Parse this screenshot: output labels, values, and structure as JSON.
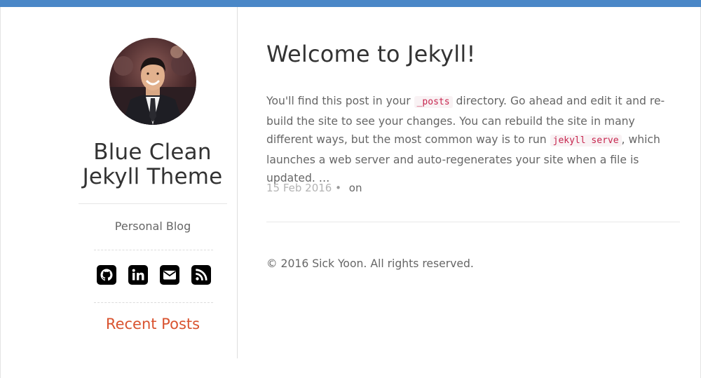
{
  "colors": {
    "topbar": "#4a87c7",
    "accent": "#d9532f",
    "code_text": "#c7254e",
    "code_bg": "#f9f2f4"
  },
  "sidebar": {
    "avatar_alt": "profile photo",
    "title_line1": "Blue Clean",
    "title_line2": "Jekyll Theme",
    "tagline": "Personal Blog",
    "social_icons": [
      "github-icon",
      "linkedin-icon",
      "email-icon",
      "rss-icon"
    ],
    "recent_posts_label": "Recent Posts"
  },
  "post": {
    "title": "Welcome to Jekyll!",
    "excerpt": {
      "part1": "You'll find this post in your ",
      "code1": "_posts",
      "part2": " directory. Go ahead and edit it and re-build the site to see your changes. You can rebuild the site in many different ways, but the most common way is to run ",
      "code2": "jekyll serve",
      "part3": ", which launches a web server and auto-regenerates your site when a file is updated. …"
    },
    "date": "15 Feb 2016",
    "separator": "•",
    "on_label": "on"
  },
  "footer": {
    "copyright": "© 2016 Sick Yoon. All rights reserved."
  }
}
